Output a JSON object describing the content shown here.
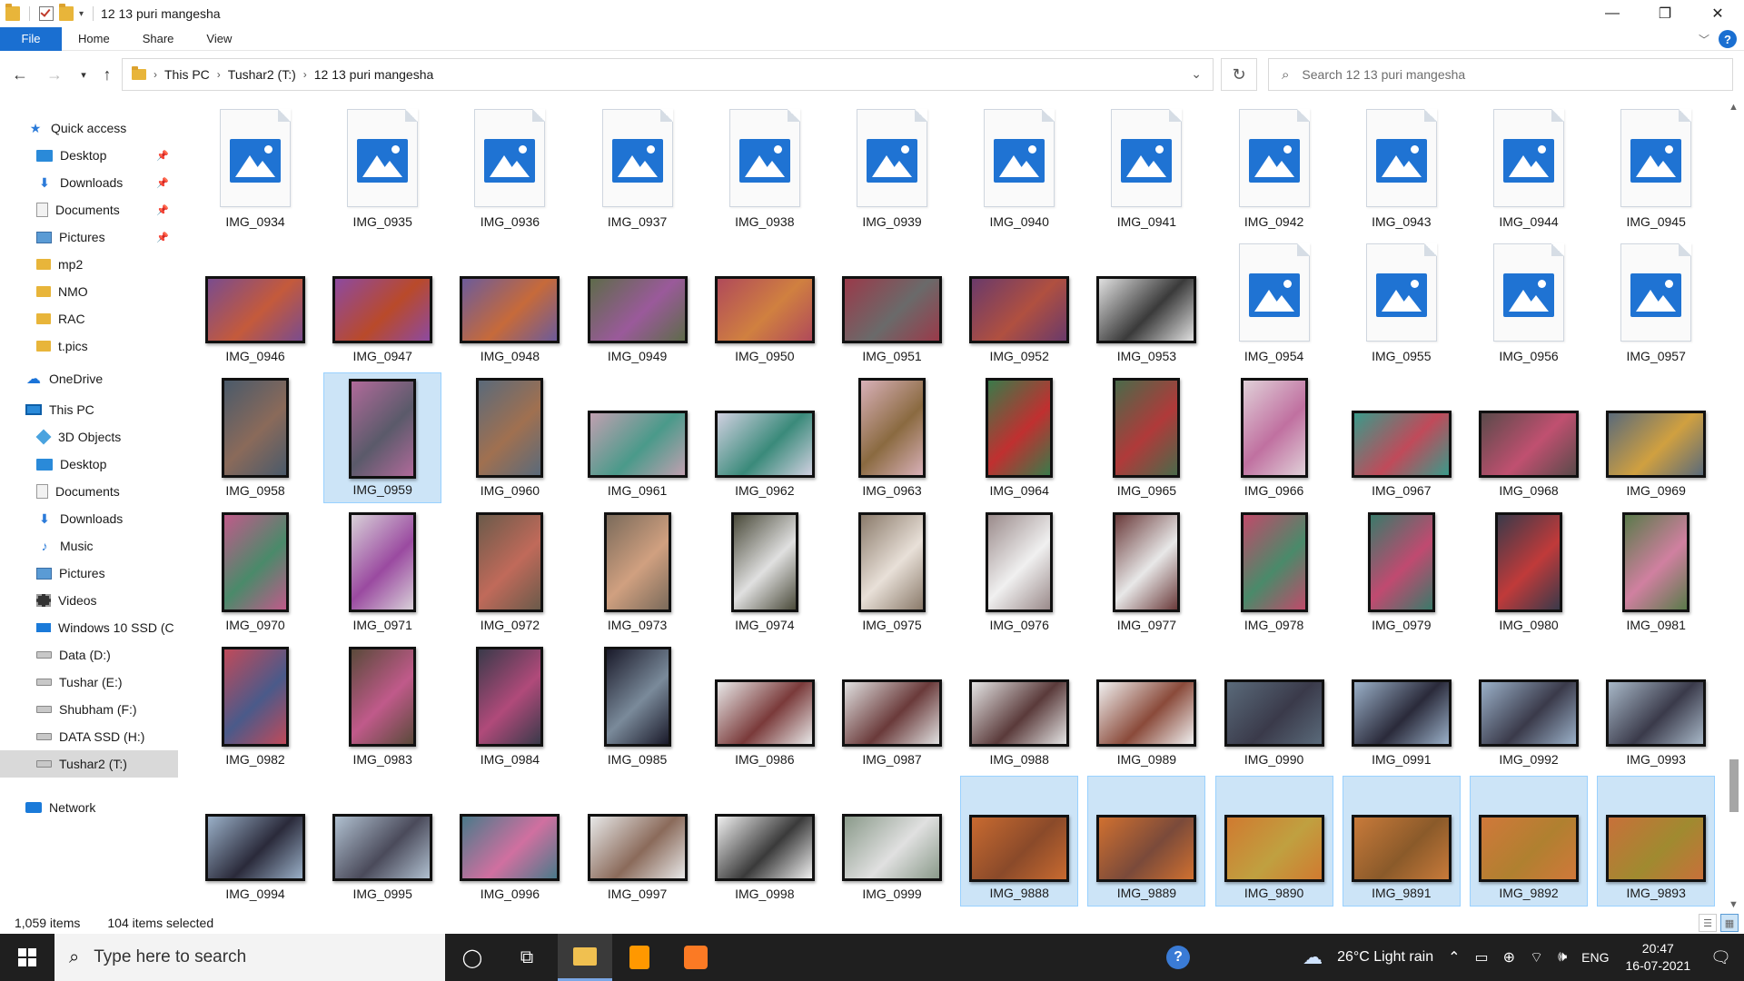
{
  "window": {
    "title": "12 13 puri mangesha",
    "minimize_glyph": "—",
    "maximize_glyph": "❐",
    "close_glyph": "✕"
  },
  "ribbon": {
    "tabs": [
      "File",
      "Home",
      "Share",
      "View"
    ]
  },
  "address": {
    "crumbs": [
      "This PC",
      "Tushar2 (T:)",
      "12 13 puri mangesha"
    ],
    "search_placeholder": "Search 12 13 puri mangesha"
  },
  "nav": {
    "items": [
      {
        "label": "Quick access",
        "icon": "star-icon"
      },
      {
        "label": "Desktop",
        "icon": "desktop-icon",
        "pinned": true
      },
      {
        "label": "Downloads",
        "icon": "download-icon",
        "pinned": true
      },
      {
        "label": "Documents",
        "icon": "document-icon",
        "pinned": true
      },
      {
        "label": "Pictures",
        "icon": "pictures-icon",
        "pinned": true
      },
      {
        "label": "mp2",
        "icon": "folder-icon"
      },
      {
        "label": "NMO",
        "icon": "folder-icon"
      },
      {
        "label": "RAC",
        "icon": "folder-icon"
      },
      {
        "label": "t.pics",
        "icon": "folder-icon"
      },
      {
        "label": "OneDrive",
        "icon": "cloud-icon"
      },
      {
        "label": "This PC",
        "icon": "computer-icon"
      },
      {
        "label": "3D Objects",
        "icon": "3d-objects-icon"
      },
      {
        "label": "Desktop",
        "icon": "desktop-icon"
      },
      {
        "label": "Documents",
        "icon": "document-icon"
      },
      {
        "label": "Downloads",
        "icon": "download-icon"
      },
      {
        "label": "Music",
        "icon": "music-icon"
      },
      {
        "label": "Pictures",
        "icon": "pictures-icon"
      },
      {
        "label": "Videos",
        "icon": "video-icon"
      },
      {
        "label": "Windows 10 SSD (C",
        "icon": "windows-drive-icon"
      },
      {
        "label": "Data (D:)",
        "icon": "drive-icon"
      },
      {
        "label": "Tushar (E:)",
        "icon": "drive-icon"
      },
      {
        "label": "Shubham (F:)",
        "icon": "drive-icon"
      },
      {
        "label": "DATA SSD (H:)",
        "icon": "drive-icon"
      },
      {
        "label": "Tushar2 (T:)",
        "icon": "drive-icon",
        "selected": true
      },
      {
        "label": "Network",
        "icon": "network-icon"
      }
    ]
  },
  "files": [
    {
      "name": "IMG_0934",
      "kind": "generic"
    },
    {
      "name": "IMG_0935",
      "kind": "generic"
    },
    {
      "name": "IMG_0936",
      "kind": "generic"
    },
    {
      "name": "IMG_0937",
      "kind": "generic"
    },
    {
      "name": "IMG_0938",
      "kind": "generic"
    },
    {
      "name": "IMG_0939",
      "kind": "generic"
    },
    {
      "name": "IMG_0940",
      "kind": "generic"
    },
    {
      "name": "IMG_0941",
      "kind": "generic"
    },
    {
      "name": "IMG_0942",
      "kind": "generic"
    },
    {
      "name": "IMG_0943",
      "kind": "generic"
    },
    {
      "name": "IMG_0944",
      "kind": "generic"
    },
    {
      "name": "IMG_0945",
      "kind": "generic"
    },
    {
      "name": "IMG_0946",
      "kind": "landscape",
      "c1": "#7a4c8e",
      "c2": "#c45a3b"
    },
    {
      "name": "IMG_0947",
      "kind": "landscape",
      "c1": "#8d4aa0",
      "c2": "#b94a2a"
    },
    {
      "name": "IMG_0948",
      "kind": "landscape",
      "c1": "#6c5b9a",
      "c2": "#c66a3a"
    },
    {
      "name": "IMG_0949",
      "kind": "landscape",
      "c1": "#5e6b4a",
      "c2": "#9a5a9a"
    },
    {
      "name": "IMG_0950",
      "kind": "landscape",
      "c1": "#b04a5a",
      "c2": "#d08040"
    },
    {
      "name": "IMG_0951",
      "kind": "landscape",
      "c1": "#9a3a4a",
      "c2": "#6a6a6a"
    },
    {
      "name": "IMG_0952",
      "kind": "landscape",
      "c1": "#6a3a6a",
      "c2": "#b05040"
    },
    {
      "name": "IMG_0953",
      "kind": "landscape",
      "c1": "#e0e0e0",
      "c2": "#3a3a3a"
    },
    {
      "name": "IMG_0954",
      "kind": "generic"
    },
    {
      "name": "IMG_0955",
      "kind": "generic"
    },
    {
      "name": "IMG_0956",
      "kind": "generic"
    },
    {
      "name": "IMG_0957",
      "kind": "generic"
    },
    {
      "name": "IMG_0958",
      "kind": "portrait",
      "c1": "#4a5a6a",
      "c2": "#8a6a5a"
    },
    {
      "name": "IMG_0959",
      "kind": "portrait",
      "c1": "#b06a9a",
      "c2": "#5a5a6a",
      "selected": true
    },
    {
      "name": "IMG_0960",
      "kind": "portrait",
      "c1": "#5a6a7a",
      "c2": "#a07050"
    },
    {
      "name": "IMG_0961",
      "kind": "landscape",
      "c1": "#c0a0b0",
      "c2": "#4a9a8a"
    },
    {
      "name": "IMG_0962",
      "kind": "landscape",
      "c1": "#d0d0e0",
      "c2": "#3a8a7a"
    },
    {
      "name": "IMG_0963",
      "kind": "portrait",
      "c1": "#d8b0b8",
      "c2": "#8a6a40"
    },
    {
      "name": "IMG_0964",
      "kind": "portrait",
      "c1": "#3a7a4a",
      "c2": "#c03030"
    },
    {
      "name": "IMG_0965",
      "kind": "portrait",
      "c1": "#4a6a4a",
      "c2": "#b03a3a"
    },
    {
      "name": "IMG_0966",
      "kind": "portrait",
      "c1": "#e0d0d8",
      "c2": "#c070a0"
    },
    {
      "name": "IMG_0967",
      "kind": "landscape",
      "c1": "#3a9a8a",
      "c2": "#c04a5a"
    },
    {
      "name": "IMG_0968",
      "kind": "landscape",
      "c1": "#5a4a4a",
      "c2": "#c05070"
    },
    {
      "name": "IMG_0969",
      "kind": "landscape",
      "c1": "#5a6a7a",
      "c2": "#d0a040"
    },
    {
      "name": "IMG_0970",
      "kind": "portrait",
      "c1": "#c05a8a",
      "c2": "#4a8a6a"
    },
    {
      "name": "IMG_0971",
      "kind": "portrait",
      "c1": "#d8d0d8",
      "c2": "#9a4aa0"
    },
    {
      "name": "IMG_0972",
      "kind": "portrait",
      "c1": "#6a5a4a",
      "c2": "#c06a5a"
    },
    {
      "name": "IMG_0973",
      "kind": "portrait",
      "c1": "#7a6a5a",
      "c2": "#d0a080"
    },
    {
      "name": "IMG_0974",
      "kind": "portrait",
      "c1": "#4a4a3a",
      "c2": "#e0e0e0"
    },
    {
      "name": "IMG_0975",
      "kind": "portrait",
      "c1": "#8a7a6a",
      "c2": "#e8e0d8"
    },
    {
      "name": "IMG_0976",
      "kind": "portrait",
      "c1": "#9a8a8a",
      "c2": "#f0f0f0"
    },
    {
      "name": "IMG_0977",
      "kind": "portrait",
      "c1": "#6a3a3a",
      "c2": "#e8e8e8"
    },
    {
      "name": "IMG_0978",
      "kind": "portrait",
      "c1": "#c04a6a",
      "c2": "#4a8a6a"
    },
    {
      "name": "IMG_0979",
      "kind": "portrait",
      "c1": "#3a7a6a",
      "c2": "#c04a70"
    },
    {
      "name": "IMG_0980",
      "kind": "portrait",
      "c1": "#3a3a4a",
      "c2": "#c03a3a"
    },
    {
      "name": "IMG_0981",
      "kind": "portrait",
      "c1": "#5a7a4a",
      "c2": "#d080a0"
    },
    {
      "name": "IMG_0982",
      "kind": "portrait",
      "c1": "#c04a5a",
      "c2": "#4a5a8a"
    },
    {
      "name": "IMG_0983",
      "kind": "portrait",
      "c1": "#5a4a3a",
      "c2": "#c05a8a"
    },
    {
      "name": "IMG_0984",
      "kind": "portrait",
      "c1": "#3a3a4a",
      "c2": "#b04a7a"
    },
    {
      "name": "IMG_0985",
      "kind": "portrait",
      "c1": "#1a1a2a",
      "c2": "#7a8a9a"
    },
    {
      "name": "IMG_0986",
      "kind": "landscape",
      "c1": "#e8e8e8",
      "c2": "#7a3a3a"
    },
    {
      "name": "IMG_0987",
      "kind": "landscape",
      "c1": "#e0e0e0",
      "c2": "#6a3a3a"
    },
    {
      "name": "IMG_0988",
      "kind": "landscape",
      "c1": "#e4e4e4",
      "c2": "#5a3a3a"
    },
    {
      "name": "IMG_0989",
      "kind": "landscape",
      "c1": "#f0f0f0",
      "c2": "#8a4a3a"
    },
    {
      "name": "IMG_0990",
      "kind": "landscape",
      "c1": "#5a6a7a",
      "c2": "#3a3a4a"
    },
    {
      "name": "IMG_0991",
      "kind": "landscape",
      "c1": "#9ab0c8",
      "c2": "#2a2a3a"
    },
    {
      "name": "IMG_0992",
      "kind": "landscape",
      "c1": "#9ab0c8",
      "c2": "#3a3a4a"
    },
    {
      "name": "IMG_0993",
      "kind": "landscape",
      "c1": "#a8b8c8",
      "c2": "#3a3a4a"
    },
    {
      "name": "IMG_0994",
      "kind": "landscape",
      "c1": "#9ab0c8",
      "c2": "#2a2a3a"
    },
    {
      "name": "IMG_0995",
      "kind": "landscape",
      "c1": "#b0c0d0",
      "c2": "#4a4a5a"
    },
    {
      "name": "IMG_0996",
      "kind": "landscape",
      "c1": "#4a7a8a",
      "c2": "#d070a0"
    },
    {
      "name": "IMG_0997",
      "kind": "landscape",
      "c1": "#e8e8e8",
      "c2": "#8a6a5a"
    },
    {
      "name": "IMG_0998",
      "kind": "landscape",
      "c1": "#f0f0f0",
      "c2": "#3a3a3a"
    },
    {
      "name": "IMG_0999",
      "kind": "landscape",
      "c1": "#8a9a8a",
      "c2": "#e0e0e0"
    },
    {
      "name": "IMG_9888",
      "kind": "landscape",
      "c1": "#c86a30",
      "c2": "#8a4a2a",
      "selected": true
    },
    {
      "name": "IMG_9889",
      "kind": "landscape",
      "c1": "#d07030",
      "c2": "#7a4a3a",
      "selected": true
    },
    {
      "name": "IMG_9890",
      "kind": "landscape",
      "c1": "#d07a30",
      "c2": "#c0a040",
      "selected": true
    },
    {
      "name": "IMG_9891",
      "kind": "landscape",
      "c1": "#c87a3a",
      "c2": "#8a5a2a",
      "selected": true
    },
    {
      "name": "IMG_9892",
      "kind": "landscape",
      "c1": "#d0783a",
      "c2": "#b08030",
      "selected": true
    },
    {
      "name": "IMG_9893",
      "kind": "landscape",
      "c1": "#c8703a",
      "c2": "#a08a30",
      "selected": true
    }
  ],
  "status": {
    "item_count": "1,059 items",
    "selected_count": "104 items selected"
  },
  "taskbar": {
    "search_placeholder": "Type here to search",
    "weather": "26°C  Light rain",
    "language": "ENG",
    "time": "20:47",
    "date": "16-07-2021"
  }
}
